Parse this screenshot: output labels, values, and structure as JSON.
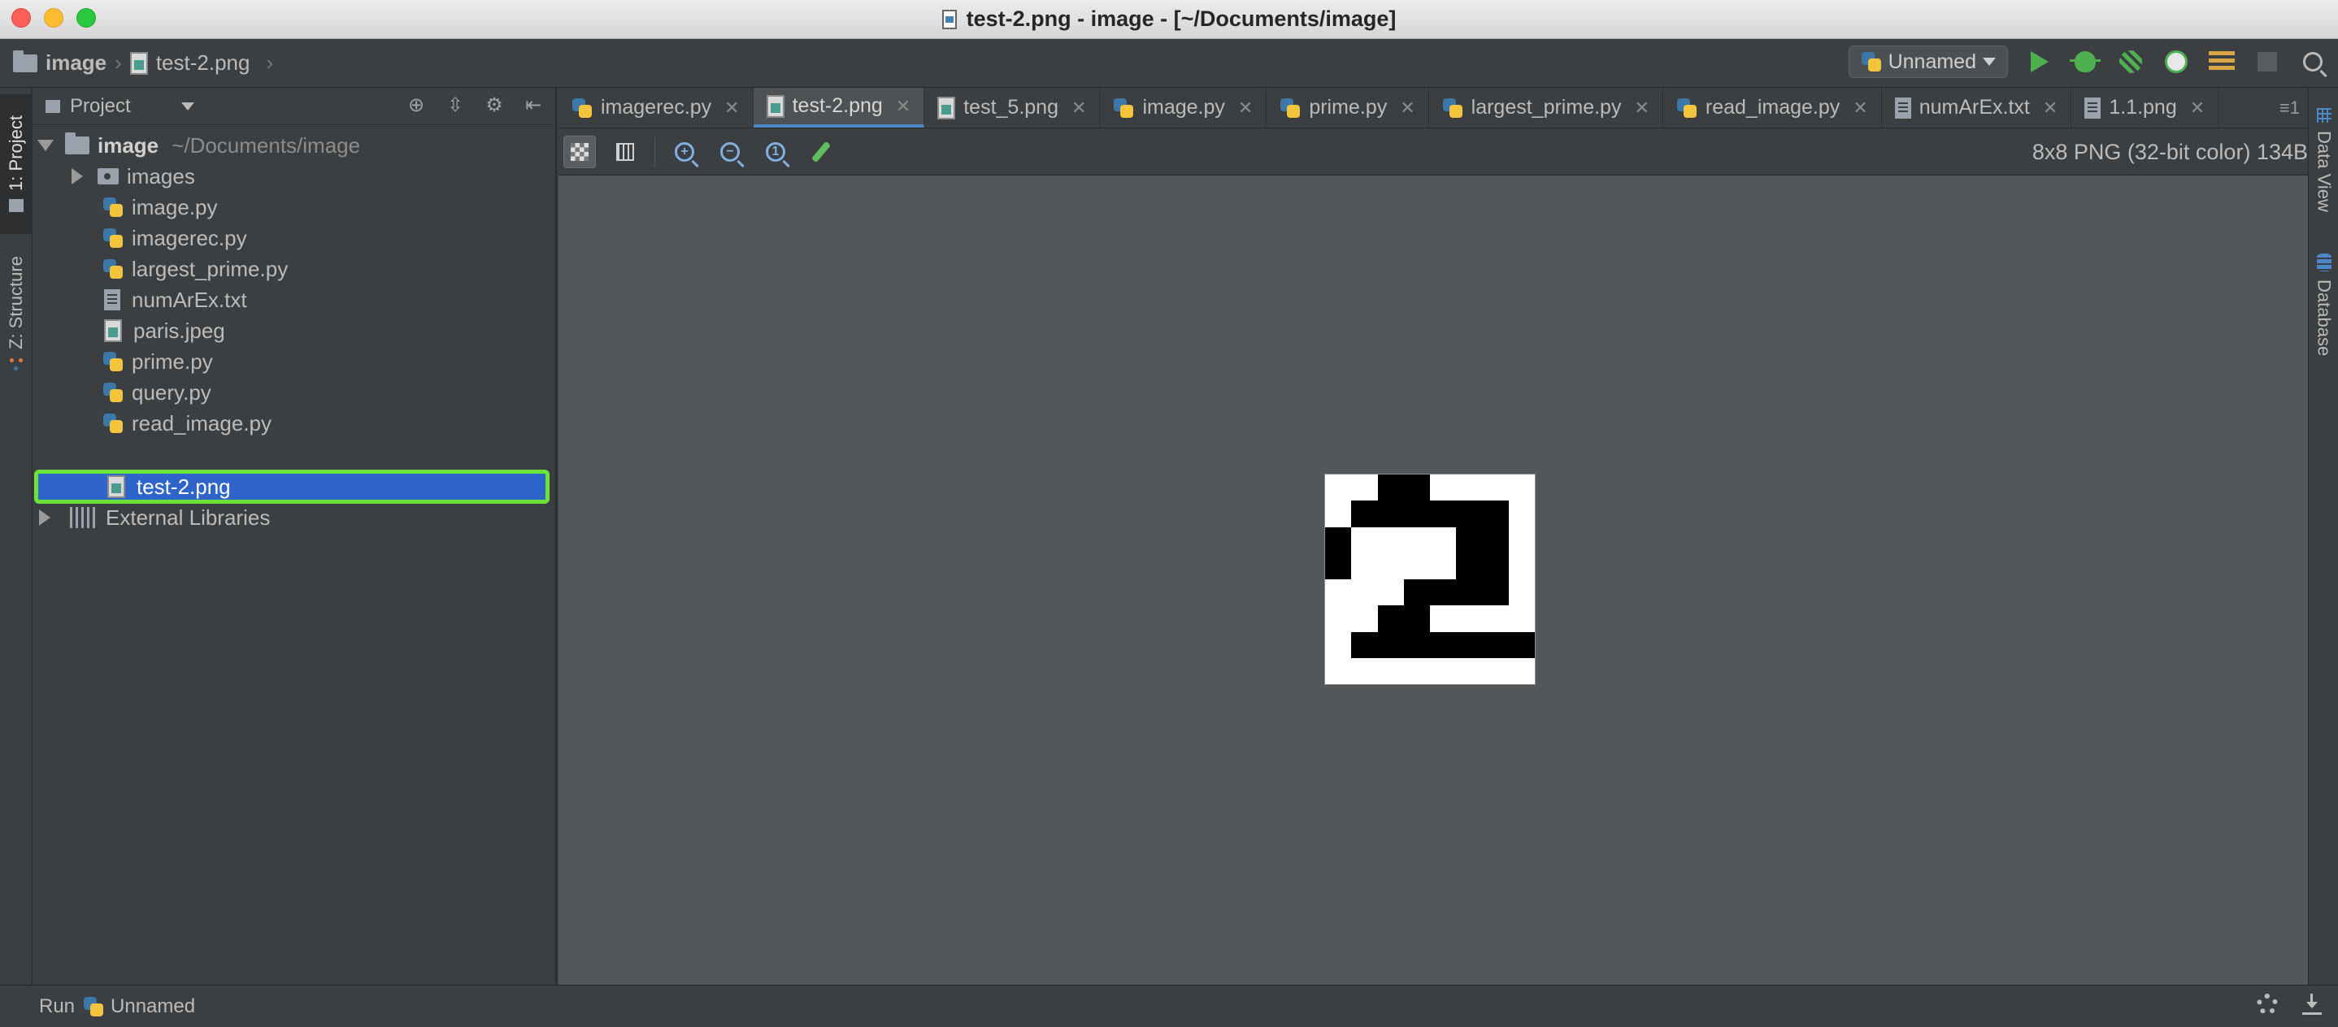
{
  "window": {
    "title": "test-2.png - image - [~/Documents/image]"
  },
  "navbar": {
    "crumbs": [
      "image",
      "test-2.png"
    ],
    "run_config": "Unnamed"
  },
  "left_strip": {
    "project_tab": "1: Project",
    "structure_tab": "Z: Structure"
  },
  "project_panel": {
    "header": "Project",
    "root": {
      "name": "image",
      "path": "~/Documents/image"
    },
    "items": [
      {
        "name": "images",
        "type": "folder",
        "icon": "folder-icon"
      },
      {
        "name": "image.py",
        "type": "python",
        "icon": "python-file-icon"
      },
      {
        "name": "imagerec.py",
        "type": "python",
        "icon": "python-file-icon"
      },
      {
        "name": "largest_prime.py",
        "type": "python",
        "icon": "python-file-icon"
      },
      {
        "name": "numArEx.txt",
        "type": "text",
        "icon": "text-file-icon"
      },
      {
        "name": "paris.jpeg",
        "type": "image",
        "icon": "image-file-icon"
      },
      {
        "name": "prime.py",
        "type": "python",
        "icon": "python-file-icon"
      },
      {
        "name": "query.py",
        "type": "python",
        "icon": "python-file-icon"
      },
      {
        "name": "read_image.py",
        "type": "python",
        "icon": "python-file-icon"
      },
      {
        "name": "test-2.png",
        "type": "image",
        "icon": "image-file-icon",
        "selected": true
      }
    ],
    "external": "External Libraries"
  },
  "tabs": [
    {
      "label": "imagerec.py",
      "icon": "python-file-icon"
    },
    {
      "label": "test-2.png",
      "icon": "image-file-icon",
      "active": true
    },
    {
      "label": "test_5.png",
      "icon": "image-file-icon"
    },
    {
      "label": "image.py",
      "icon": "python-file-icon"
    },
    {
      "label": "prime.py",
      "icon": "python-file-icon"
    },
    {
      "label": "largest_prime.py",
      "icon": "python-file-icon"
    },
    {
      "label": "read_image.py",
      "icon": "python-file-icon"
    },
    {
      "label": "numArEx.txt",
      "icon": "text-file-icon"
    },
    {
      "label": "1.1.png",
      "icon": "image-file-icon"
    }
  ],
  "tabs_overflow": "≡1",
  "image_toolbar": {
    "info": "8x8 PNG (32-bit color) 134B"
  },
  "image_pixels": [
    "wwbbwwww",
    "wbbbbbbw",
    "bwwwwbbw",
    "bwwwwbbw",
    "wwwbbbbw",
    "wwbbwwww",
    "wbbbbbbb",
    "wwwwwwww"
  ],
  "right_strip": {
    "data_view": "Data View",
    "database": "Database"
  },
  "statusbar": {
    "run_label": "Run",
    "run_config": "Unnamed"
  }
}
